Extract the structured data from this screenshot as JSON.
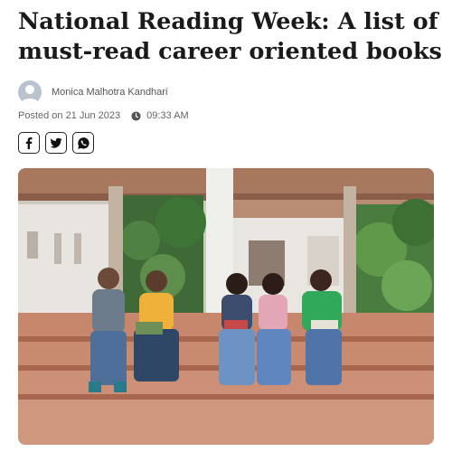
{
  "article": {
    "title": "National Reading Week: A list of must-read career oriented books",
    "author": "Monica Malhotra Kandhari",
    "posted_label": "Posted on 21 Jun 2023",
    "time": "09:33 AM"
  },
  "share": {
    "items": [
      {
        "icon": "facebook-icon"
      },
      {
        "icon": "twitter-icon"
      },
      {
        "icon": "whatsapp-icon"
      }
    ]
  },
  "hero_image": {
    "subject": "students-reading-on-steps"
  },
  "colors": {
    "title": "#1a1a1a",
    "meta_text": "#666666",
    "avatar_bg": "#b9c3cd"
  }
}
